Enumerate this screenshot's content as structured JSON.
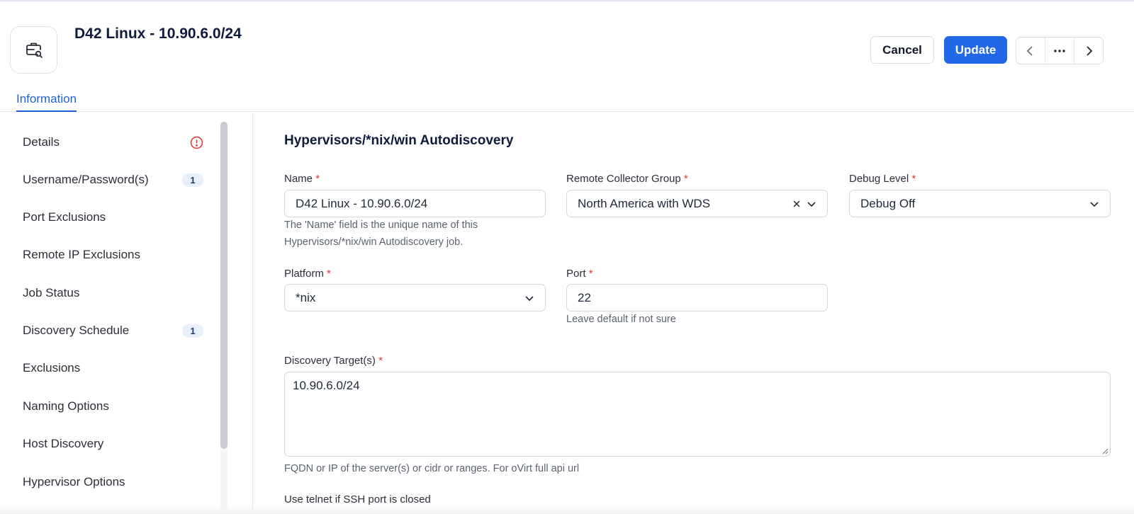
{
  "header": {
    "title": "D42 Linux - 10.90.6.0/24",
    "cancel_label": "Cancel",
    "update_label": "Update"
  },
  "tabs": [
    {
      "label": "Information",
      "active": true
    }
  ],
  "sidebar": {
    "items": [
      {
        "label": "Details",
        "indicator": "error-icon"
      },
      {
        "label": "Username/Password(s)",
        "badge": "1"
      },
      {
        "label": "Port Exclusions"
      },
      {
        "label": "Remote IP Exclusions"
      },
      {
        "label": "Job Status"
      },
      {
        "label": "Discovery Schedule",
        "badge": "1"
      },
      {
        "label": "Exclusions"
      },
      {
        "label": "Naming Options"
      },
      {
        "label": "Host Discovery"
      },
      {
        "label": "Hypervisor Options"
      }
    ]
  },
  "form": {
    "section_title": "Hypervisors/*nix/win Autodiscovery",
    "required_mark": "*",
    "name": {
      "label": "Name",
      "value": "D42 Linux - 10.90.6.0/24",
      "help_line1": "The 'Name' field is the unique name of this",
      "help_line2": "Hypervisors/*nix/win Autodiscovery job."
    },
    "remote_collector_group": {
      "label": "Remote Collector Group",
      "value": "North America with WDS"
    },
    "debug_level": {
      "label": "Debug Level",
      "value": "Debug Off"
    },
    "platform": {
      "label": "Platform",
      "value": "*nix"
    },
    "port": {
      "label": "Port",
      "value": "22",
      "help": "Leave default if not sure"
    },
    "discovery_targets": {
      "label": "Discovery Target(s)",
      "value": "10.90.6.0/24",
      "help": "FQDN or IP of the server(s) or cidr or ranges. For oVirt full api url"
    },
    "telnet": {
      "label": "Use telnet if SSH port is closed"
    }
  },
  "colors": {
    "accent": "#2068e6",
    "title": "#0f1b3d",
    "required": "#e0312f",
    "badge_bg": "#e7f0fb"
  }
}
